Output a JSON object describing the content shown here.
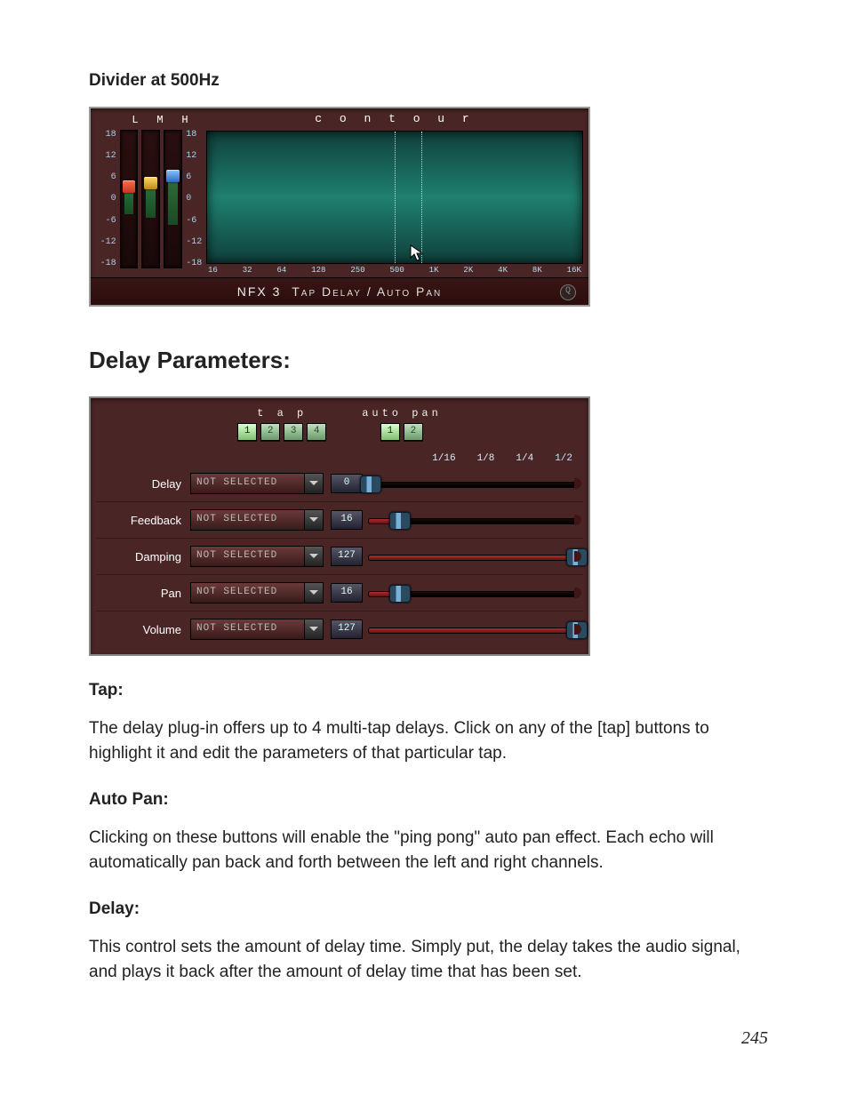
{
  "heading_divider": "Divider at 500Hz",
  "nfx_panel": {
    "lmh_labels": [
      "L",
      "M",
      "H"
    ],
    "vscale": [
      "18",
      "12",
      "6",
      "0",
      "-6",
      "-12",
      "-18"
    ],
    "contour_title": "c o n t o u r",
    "freq_axis": [
      "16",
      "32",
      "64",
      "128",
      "250",
      "500",
      "1K",
      "2K",
      "4K",
      "8K",
      "16K"
    ],
    "footer_prefix": "NFX 3",
    "footer_suffix": "Tap Delay / Auto Pan"
  },
  "heading_delay_params": "Delay Parameters:",
  "delay_panel": {
    "tap_group_label": "t a p",
    "tap_buttons": [
      "1",
      "2",
      "3",
      "4"
    ],
    "autopan_group_label": "auto pan",
    "autopan_buttons": [
      "1",
      "2"
    ],
    "time_ruler": [
      "1/16",
      "1/8",
      "1/4",
      "1/2"
    ],
    "select_default": "NOT SELECTED",
    "rows": [
      {
        "label": "Delay",
        "value": "0",
        "pct": 1
      },
      {
        "label": "Feedback",
        "value": "16",
        "pct": 15
      },
      {
        "label": "Damping",
        "value": "127",
        "pct": 100
      },
      {
        "label": "Pan",
        "value": "16",
        "pct": 15
      },
      {
        "label": "Volume",
        "value": "127",
        "pct": 100
      }
    ]
  },
  "section_tap_title": "Tap:",
  "section_tap_body": "The delay plug-in offers up to 4 multi-tap delays.  Click on any of the [tap] buttons to highlight it and edit the parameters of that particular tap.",
  "section_autopan_title": "Auto Pan:",
  "section_autopan_body": "Clicking on these buttons will enable the \"ping pong\" auto pan effect.  Each echo will automatically pan back and forth between the left and right channels.",
  "section_delay_title": "Delay:",
  "section_delay_body": "This control sets the amount of delay time.  Simply put, the delay takes the audio signal, and plays it back after the amount of delay time that has been set.",
  "page_number": "245"
}
